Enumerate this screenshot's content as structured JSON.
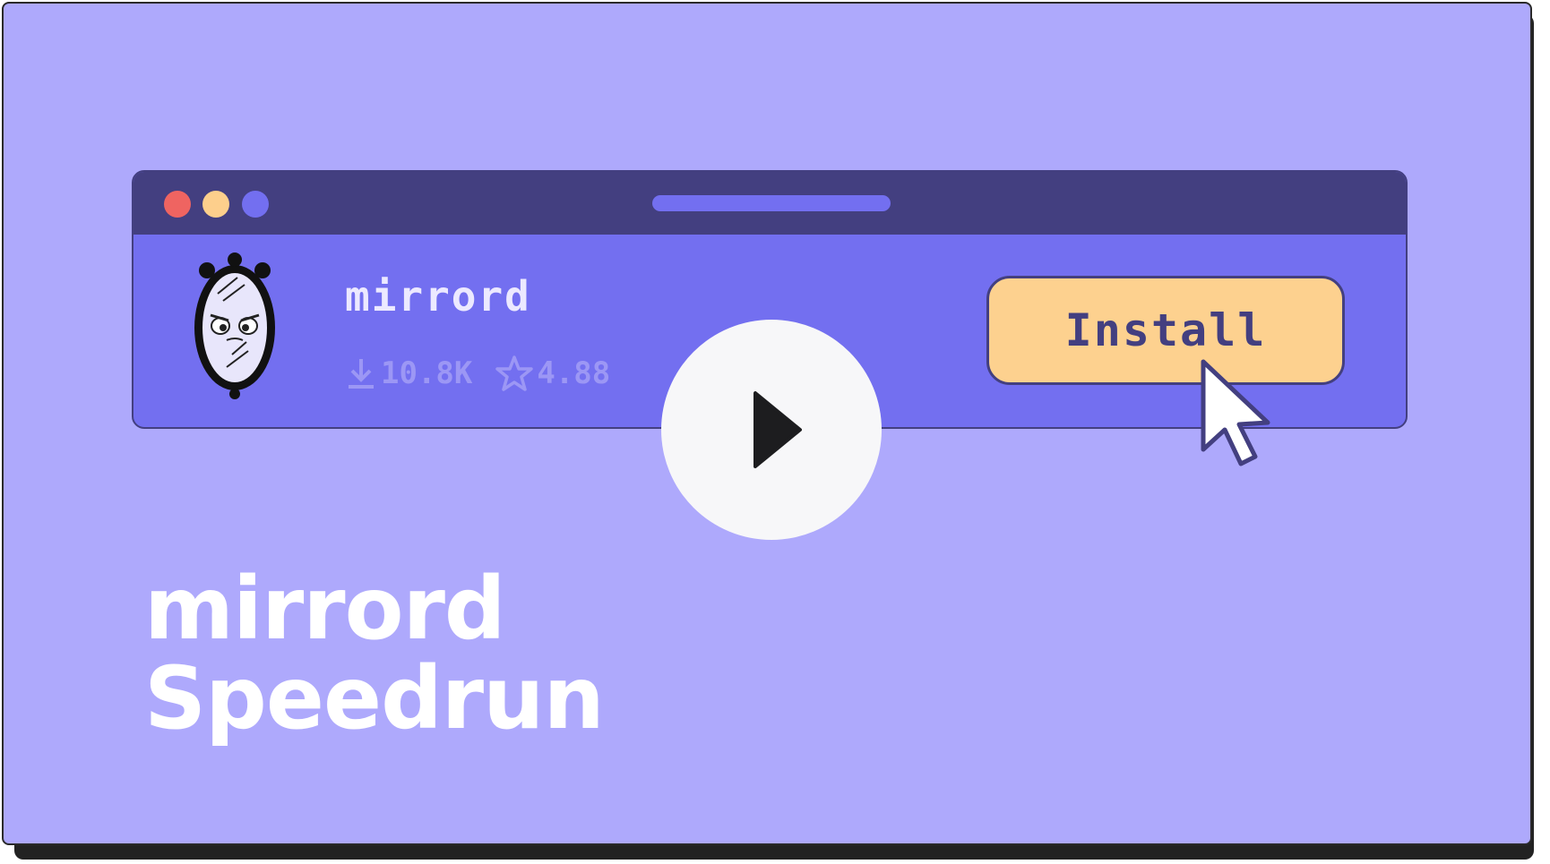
{
  "extension": {
    "name": "mirrord",
    "downloads": "10.8K",
    "rating": "4.88",
    "install_label": "Install"
  },
  "headline": {
    "line1": "mirrord",
    "line2": "Speedrun"
  },
  "icons": {
    "logo": "mirror-logo-icon",
    "download": "download-icon",
    "star": "star-icon",
    "cursor": "cursor-pointer-icon",
    "play": "play-icon"
  },
  "colors": {
    "background": "#aea9fc",
    "window_body": "#736ff0",
    "titlebar": "#433f80",
    "dot_red": "#ef6461",
    "dot_yellow": "#fdcf8c",
    "dot_blue": "#736ff0",
    "url_bar": "#736ff0",
    "install_button": "#fdd18f",
    "accent_text": "#433f80",
    "play_button": "#f7f7f9"
  }
}
